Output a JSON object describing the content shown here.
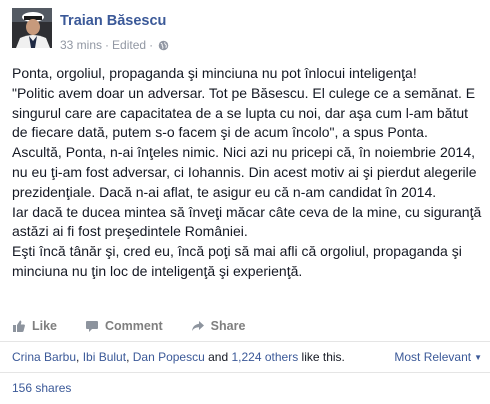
{
  "post": {
    "author": "Traian Băsescu",
    "time": "33 mins",
    "separator": "·",
    "edited": "Edited",
    "privacy_icon": "globe-icon",
    "paragraphs": [
      "Ponta, orgoliul, propaganda şi minciuna nu pot înlocui inteligenţa!",
      "\"Politic avem doar un adversar. Tot pe Băsescu. El culege ce a semănat. E singurul care are capacitatea de a se lupta cu noi, dar aşa cum l-am bătut de fiecare dată, putem s-o facem şi de acum încolo\", a spus Ponta.",
      "Ascultă, Ponta, n-ai înţeles nimic. Nici azi nu pricepi că, în noiembrie 2014, nu eu ţi-am fost adversar, ci Iohannis. Din acest motiv ai şi pierdut alegerile prezidenţiale. Dacă n-ai aflat, te asigur eu că n-am candidat în 2014.",
      "Iar dacă te ducea mintea să înveţi măcar câte ceva de la mine, cu siguranţă astăzi ai fi fost preşedintele României.",
      "Eşti încă tânăr şi, cred eu, încă poţi să mai afli că orgoliul, propaganda şi minciuna nu ţin loc de inteligenţă şi experienţă."
    ]
  },
  "actions": {
    "like": "Like",
    "comment": "Comment",
    "share": "Share"
  },
  "likes": {
    "names": [
      "Crina Barbu",
      "Ibi Bulut",
      "Dan Popescu"
    ],
    "comma": ", ",
    "and": " and ",
    "others": "1,224 others",
    "suffix": " like this."
  },
  "sort": {
    "label": "Most Relevant",
    "caret": "▼"
  },
  "shares": "156 shares",
  "colors": {
    "link": "#3b5998",
    "meta": "#9197a3",
    "text": "#141823"
  }
}
